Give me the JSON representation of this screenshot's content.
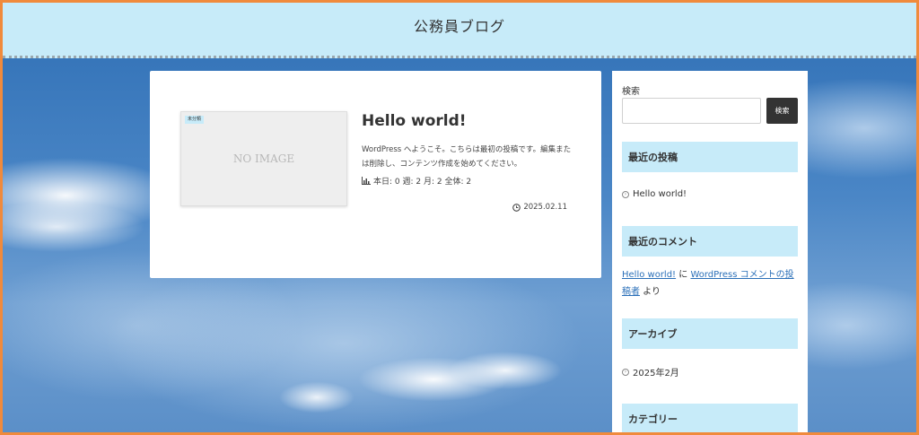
{
  "header": {
    "site_title": "公務員ブログ"
  },
  "post": {
    "category": "未分類",
    "thumbnail_text": "NO IMAGE",
    "title": "Hello world!",
    "excerpt": "WordPress へようこそ。こちらは最初の投稿です。編集または削除し、コンテンツ作成を始めてください。",
    "stats": "本日: 0  週: 2  月: 2  全体: 2",
    "date": "2025.02.11"
  },
  "sidebar": {
    "search_label": "検索",
    "search_placeholder": "",
    "search_button": "検索",
    "recent_posts": {
      "heading": "最近の投稿",
      "items": [
        "Hello world!"
      ]
    },
    "recent_comments": {
      "heading": "最近のコメント",
      "post_link": "Hello world!",
      "connector": " に ",
      "author_link": "WordPress コメントの投稿者",
      "suffix": " より"
    },
    "archives": {
      "heading": "アーカイブ",
      "items": [
        "2025年2月"
      ]
    },
    "categories": {
      "heading": "カテゴリー"
    }
  },
  "colors": {
    "header_bg": "#c7ebf9",
    "frame_border": "#f08a3c",
    "link": "#2a6fb8",
    "button_bg": "#333333"
  }
}
